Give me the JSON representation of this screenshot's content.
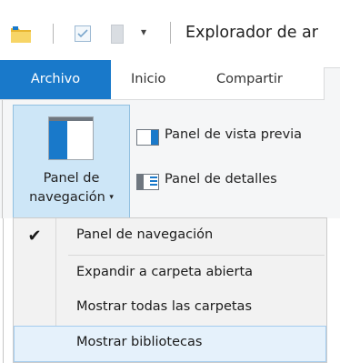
{
  "window": {
    "title": "Explorador de ar",
    "quick_access": {
      "folder_icon": "folder-icon",
      "properties_icon": "checkbox-properties-icon",
      "new_folder_icon": "page-icon",
      "customize_icon": "chevron-down-icon",
      "customize_glyph": "▾"
    }
  },
  "ribbon": {
    "tabs": [
      {
        "label": "Archivo",
        "active": true
      },
      {
        "label": "Inicio",
        "active": false
      },
      {
        "label": "Compartir",
        "active": false
      }
    ],
    "navigation_pane_button": {
      "line1": "Panel de",
      "line2": "navegación",
      "caret": "▾"
    },
    "preview_pane_label": "Panel de vista previa",
    "details_pane_label": "Panel de detalles"
  },
  "menu": {
    "items": [
      {
        "label": "Panel de navegación",
        "checked": true,
        "check_glyph": "✔"
      },
      {
        "label": "Expandir a carpeta abierta",
        "checked": false
      },
      {
        "label": "Mostrar todas las carpetas",
        "checked": false
      },
      {
        "label": "Mostrar bibliotecas",
        "checked": false,
        "hovered": true
      }
    ]
  },
  "colors": {
    "accent": "#1979ca",
    "button_highlight": "#cde6f7",
    "menu_highlight": "#e5f1fb"
  }
}
